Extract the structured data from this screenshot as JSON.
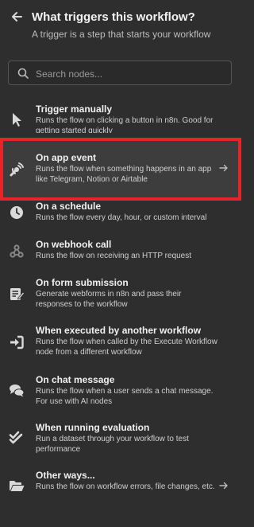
{
  "header": {
    "title": "What triggers this workflow?",
    "subtitle": "A trigger is a step that starts your workflow"
  },
  "search": {
    "placeholder": "Search nodes..."
  },
  "items": [
    {
      "icon": "pointer-icon",
      "name": "Trigger manually",
      "desc": "Runs the flow on clicking a button in n8n. Good for getting started quickly"
    },
    {
      "icon": "app-event-icon",
      "name": "On app event",
      "desc": "Runs the flow when something happens in an app like Telegram, Notion or Airtable"
    },
    {
      "icon": "clock-icon",
      "name": "On a schedule",
      "desc": "Runs the flow every day, hour, or custom interval"
    },
    {
      "icon": "webhook-icon",
      "name": "On webhook call",
      "desc": "Runs the flow on receiving an HTTP request"
    },
    {
      "icon": "form-icon",
      "name": "On form submission",
      "desc": "Generate webforms in n8n and pass their responses to the workflow"
    },
    {
      "icon": "sign-in-icon",
      "name": "When executed by another workflow",
      "desc": "Runs the flow when called by the Execute Workflow node from a different workflow"
    },
    {
      "icon": "chat-icon",
      "name": "On chat message",
      "desc": "Runs the flow when a user sends a chat message. For use with AI nodes"
    },
    {
      "icon": "check-double-icon",
      "name": "When running evaluation",
      "desc": "Run a dataset through your workflow to test performance"
    },
    {
      "icon": "folder-open-icon",
      "name": "Other ways...",
      "desc": "Runs the flow on workflow errors, file changes, etc."
    }
  ],
  "colors": {
    "background": "#2e2e2e",
    "selected": "#3d3d3d",
    "highlight": "#e8242a"
  }
}
